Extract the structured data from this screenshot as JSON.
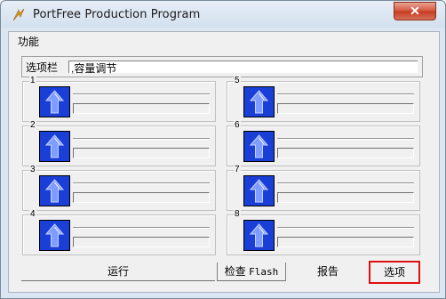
{
  "window": {
    "title": "PortFree Production Program",
    "close_label": "✕"
  },
  "menu": {
    "items": [
      "功能"
    ]
  },
  "options": {
    "label": "选项栏",
    "value": ",容量调节"
  },
  "ports": [
    {
      "number": "1"
    },
    {
      "number": "2"
    },
    {
      "number": "3"
    },
    {
      "number": "4"
    },
    {
      "number": "5"
    },
    {
      "number": "6"
    },
    {
      "number": "7"
    },
    {
      "number": "8"
    }
  ],
  "buttons": {
    "run": "运行",
    "check_flash_prefix": "检查",
    "check_flash_suffix": "Flash",
    "report": "报告",
    "options": "选项"
  },
  "colors": {
    "port_icon": "#1a3fd6",
    "highlight": "#e01010"
  },
  "icons": {
    "app": "portfree-app-icon",
    "port": "usb-upload-arrow-icon"
  }
}
